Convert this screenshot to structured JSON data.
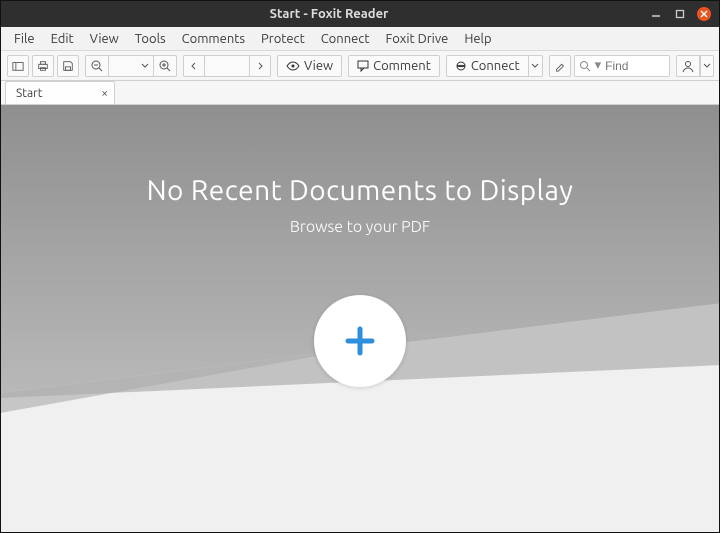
{
  "titlebar": {
    "title": "Start - Foxit Reader"
  },
  "menu": {
    "file": "File",
    "edit": "Edit",
    "view": "View",
    "tools": "Tools",
    "comments": "Comments",
    "protect": "Protect",
    "connect": "Connect",
    "foxit_drive": "Foxit Drive",
    "help": "Help"
  },
  "toolbar": {
    "view_label": "View",
    "comment_label": "Comment",
    "connect_label": "Connect"
  },
  "search": {
    "placeholder": "Find"
  },
  "tabs": {
    "start": "Start"
  },
  "start_page": {
    "heading": "No Recent Documents to Display",
    "subtitle": "Browse to your PDF"
  }
}
